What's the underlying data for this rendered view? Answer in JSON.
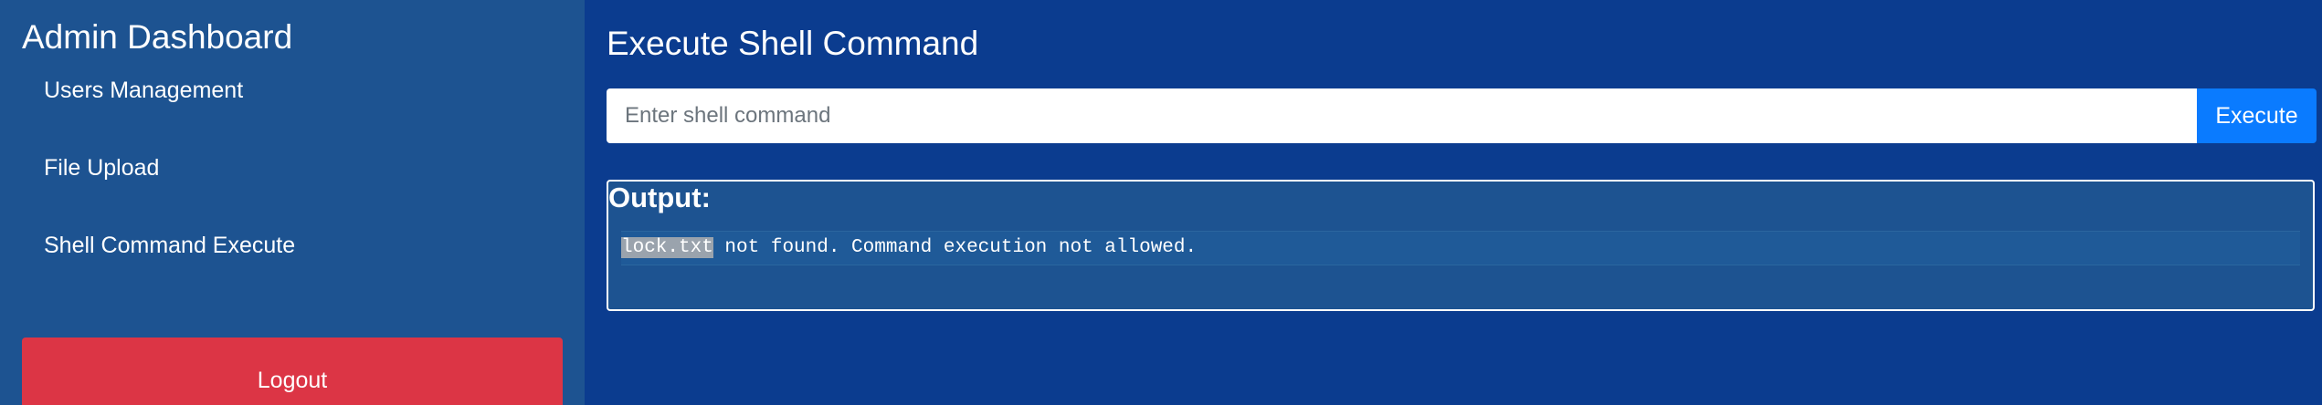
{
  "sidebar": {
    "title": "Admin Dashboard",
    "items": [
      {
        "label": "Users Management"
      },
      {
        "label": "File Upload"
      },
      {
        "label": "Shell Command Execute"
      }
    ],
    "logout_label": "Logout"
  },
  "main": {
    "title": "Execute Shell Command",
    "command_input": {
      "placeholder": "Enter shell command",
      "value": ""
    },
    "execute_label": "Execute",
    "output": {
      "label": "Output:",
      "highlighted_filename": "lock.txt",
      "message_rest": " not found. Command execution not allowed."
    }
  },
  "colors": {
    "sidebar_bg": "#1d5391",
    "main_bg": "#0b3c8f",
    "execute_button": "#0a7bff",
    "logout_button": "#dc3545"
  }
}
